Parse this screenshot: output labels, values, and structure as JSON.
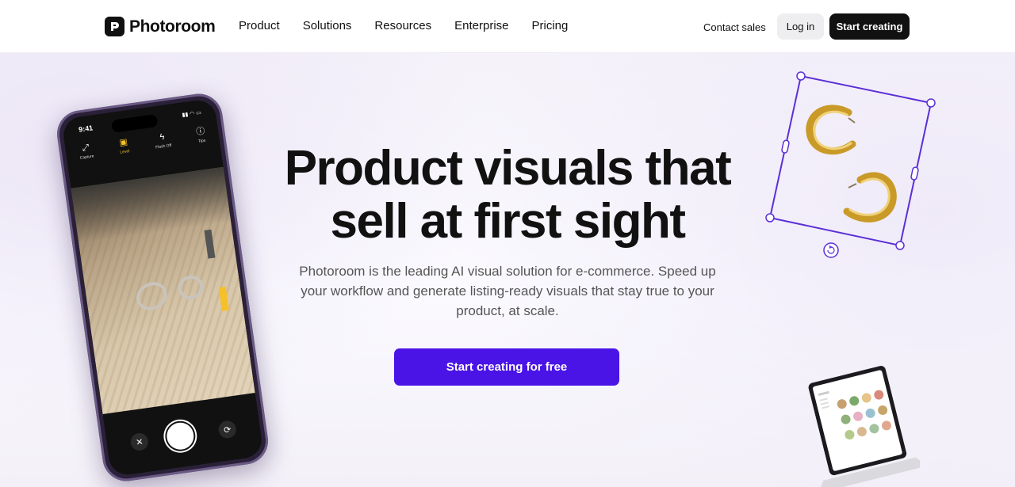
{
  "nav": {
    "logo_text": "Photoroom",
    "links": [
      "Product",
      "Solutions",
      "Resources",
      "Enterprise",
      "Pricing"
    ],
    "contact_sales": "Contact sales",
    "login": "Log in",
    "start_creating": "Start creating"
  },
  "hero": {
    "headline_line1": "Product visuals that",
    "headline_line2": "sell at first sight",
    "subhead": "Photoroom is the leading AI visual solution for e-commerce. Speed up your workflow and generate listing-ready visuals that stay true to your product, at scale.",
    "cta": "Start creating for free"
  },
  "phone": {
    "time": "9:41",
    "tools": [
      {
        "label": "Capture",
        "icon": "capture-icon"
      },
      {
        "label": "Level",
        "icon": "level-icon",
        "active": true
      },
      {
        "label": "Flash Off",
        "icon": "flash-off-icon"
      },
      {
        "label": "Tips",
        "icon": "tips-icon"
      }
    ]
  },
  "colors": {
    "accent": "#4a14e6",
    "selection": "#5b2fd6",
    "dark": "#111111"
  }
}
